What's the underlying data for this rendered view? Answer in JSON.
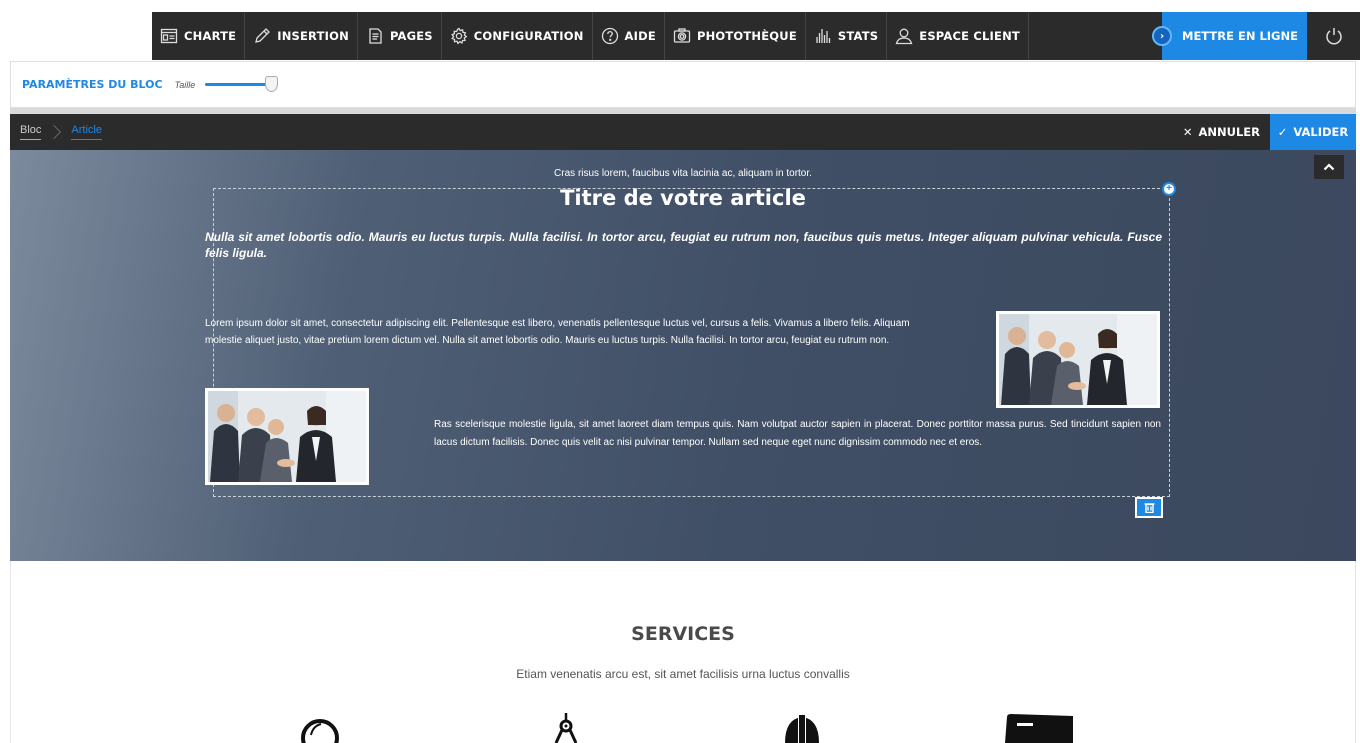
{
  "toolbar": {
    "items": [
      {
        "label": "CHARTE",
        "icon": "layout-icon"
      },
      {
        "label": "INSERTION",
        "icon": "pencil-icon"
      },
      {
        "label": "PAGES",
        "icon": "pages-icon"
      },
      {
        "label": "CONFIGURATION",
        "icon": "gear-icon"
      },
      {
        "label": "AIDE",
        "icon": "help-icon"
      },
      {
        "label": "PHOTOTHÈQUE",
        "icon": "camera-icon"
      },
      {
        "label": "STATS",
        "icon": "stats-icon"
      },
      {
        "label": "ESPACE CLIENT",
        "icon": "user-icon"
      }
    ],
    "publish_label": "METTRE EN LIGNE",
    "accent": "#1e88e5"
  },
  "params": {
    "title": "PARAMÈTRES DU BLOC",
    "size_label": "Taille",
    "size_value": 0.85
  },
  "breadcrumb": {
    "items": [
      "Bloc",
      "Article"
    ],
    "cancel_label": "ANNULER",
    "validate_label": "VALIDER"
  },
  "article": {
    "kicker": "Cras risus lorem, faucibus vita lacinia ac, aliquam in tortor.",
    "title": "Titre de votre article",
    "lead": "Nulla sit amet lobortis odio. Mauris eu luctus turpis. Nulla facilisi. In tortor arcu, feugiat eu rutrum non, faucibus quis metus. Integer aliquam pulvinar vehicula. Fusce felis ligula.",
    "para1": "Lorem ipsum dolor sit amet, consectetur adipiscing elit. Pellentesque est libero, venenatis pellentesque luctus vel, cursus a felis. Vivamus a libero felis. Aliquam molestie aliquet justo, vitae pretium lorem dictum vel. Nulla sit amet lobortis odio. Mauris eu luctus turpis. Nulla facilisi. In tortor arcu, feugiat eu rutrum non.",
    "para2": "Ras scelerisque molestie ligula, sit amet laoreet diam tempus quis. Nam volutpat auctor sapien in placerat. Donec porttitor massa purus. Sed tincidunt sapien non lacus dictum facilisis. Donec quis velit ac nisi pulvinar tempor. Nullam sed neque eget nunc dignissim commodo nec et eros."
  },
  "services": {
    "title": "SERVICES",
    "subtitle": "Etiam venenatis arcu est, sit amet facilisis urna luctus convallis",
    "icons": [
      "magnifier-icon",
      "compass-icon",
      "helmet-icon",
      "server-icon"
    ]
  }
}
